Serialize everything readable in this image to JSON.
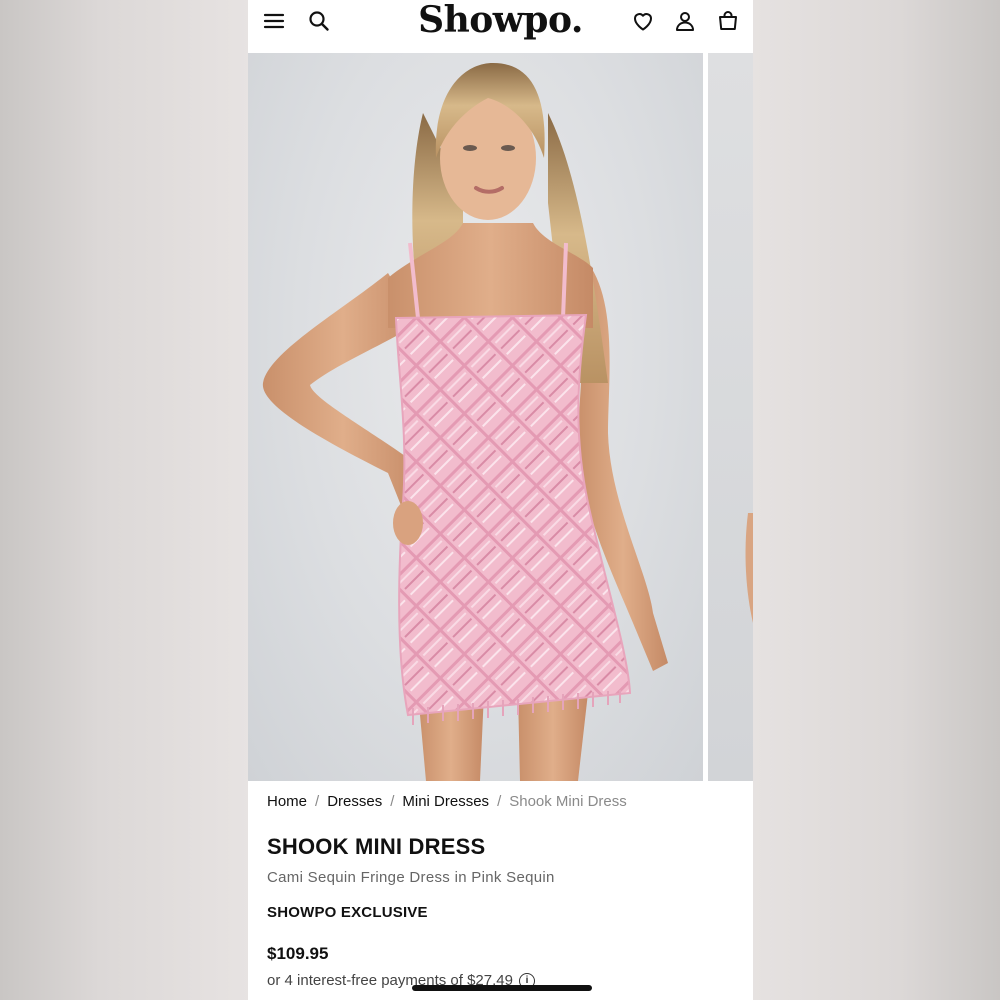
{
  "header": {
    "logo": "Showpo.",
    "icons": [
      "menu-icon",
      "search-icon",
      "wishlist-heart-icon",
      "account-icon",
      "bag-icon"
    ]
  },
  "breadcrumb": {
    "items": [
      "Home",
      "Dresses",
      "Mini Dresses"
    ],
    "separator": "/",
    "current": "Shook Mini Dress"
  },
  "product": {
    "name": "SHOOK MINI DRESS",
    "subtitle": "Cami Sequin Fringe Dress in Pink Sequin",
    "badge": "SHOWPO EXCLUSIVE",
    "price": "$109.95",
    "installments": "or 4 interest-free payments of $27.49"
  },
  "colors": {
    "dress": "#f0b3c6",
    "background": "#e6e2e1",
    "text": "#111111"
  }
}
